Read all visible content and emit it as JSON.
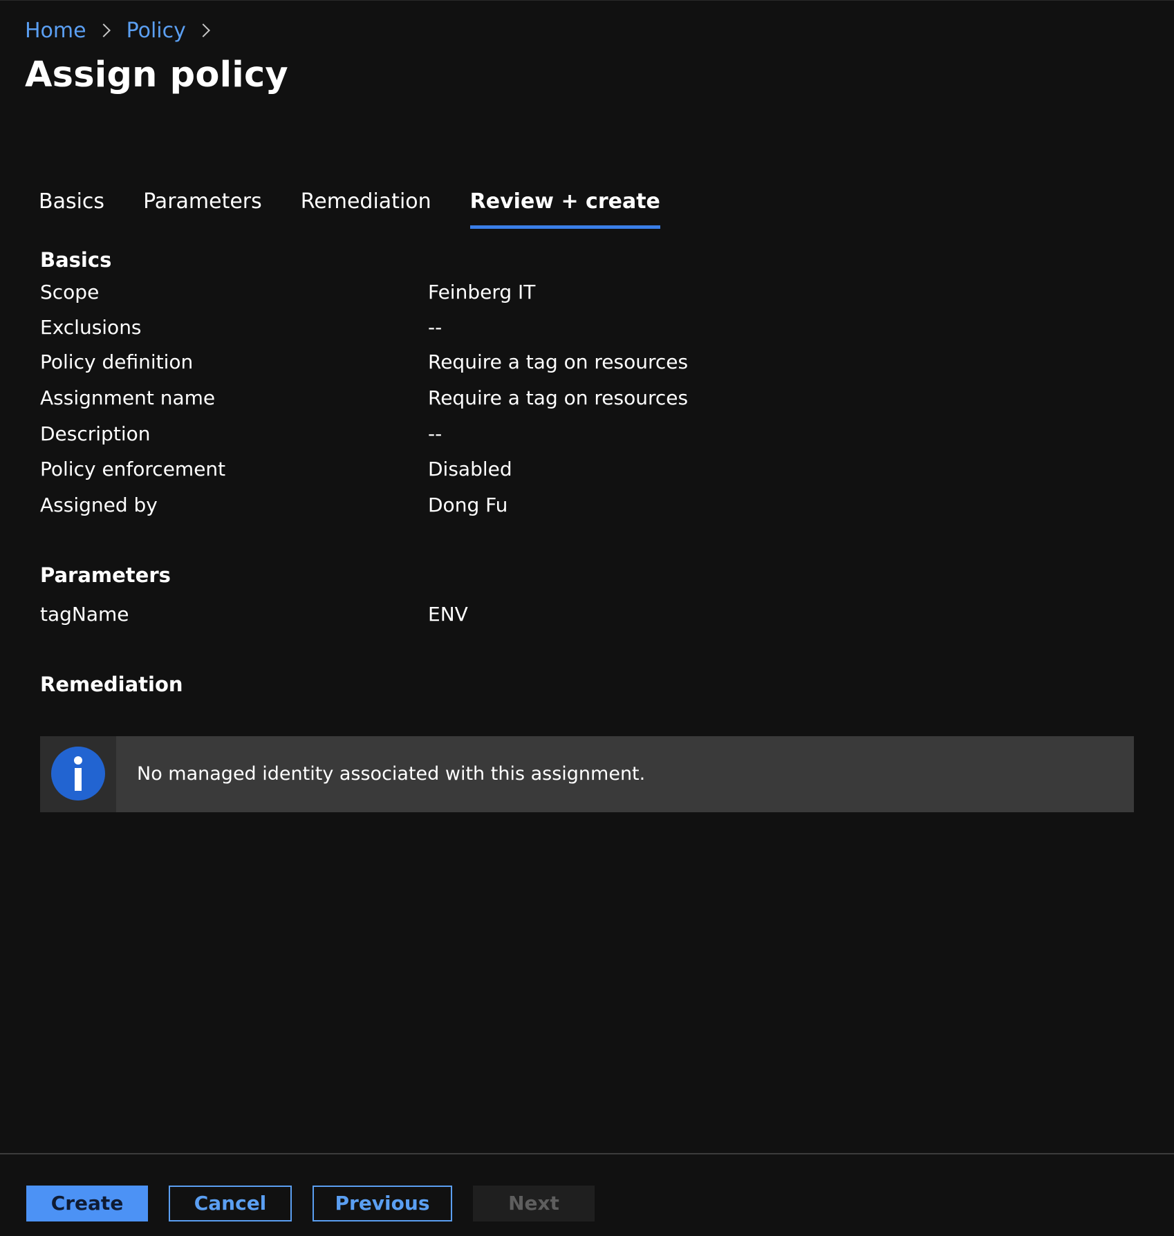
{
  "breadcrumb": {
    "items": [
      {
        "label": "Home"
      },
      {
        "label": "Policy"
      }
    ]
  },
  "page": {
    "title": "Assign policy"
  },
  "tabs": [
    {
      "label": "Basics",
      "active": false
    },
    {
      "label": "Parameters",
      "active": false
    },
    {
      "label": "Remediation",
      "active": false
    },
    {
      "label": "Review + create",
      "active": true
    }
  ],
  "review": {
    "basics": {
      "title": "Basics",
      "rows": [
        {
          "label": "Scope",
          "value": "Feinberg IT"
        },
        {
          "label": "Exclusions",
          "value": "--"
        },
        {
          "label": "Policy definition",
          "value": "Require a tag on resources"
        },
        {
          "label": "Assignment name",
          "value": "Require a tag on resources"
        },
        {
          "label": "Description",
          "value": "--"
        },
        {
          "label": "Policy enforcement",
          "value": "Disabled"
        },
        {
          "label": "Assigned by",
          "value": "Dong Fu"
        }
      ]
    },
    "parameters": {
      "title": "Parameters",
      "rows": [
        {
          "label": "tagName",
          "value": "ENV"
        }
      ]
    },
    "remediation": {
      "title": "Remediation",
      "info_icon": "info-icon",
      "info_message": "No managed identity associated with this assignment."
    }
  },
  "footer": {
    "create_label": "Create",
    "cancel_label": "Cancel",
    "previous_label": "Previous",
    "next_label": "Next",
    "next_disabled": true
  },
  "colors": {
    "background": "#111111",
    "link": "#5b9ff2",
    "accent": "#3a7ee8",
    "primary_button": "#4c92f5",
    "info_icon": "#2264d1",
    "banner": "#3a3a3a"
  }
}
